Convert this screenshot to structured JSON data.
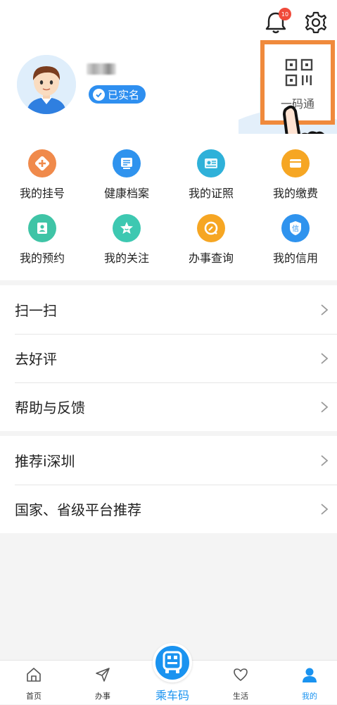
{
  "header": {
    "notification_count": "10",
    "username_masked": "",
    "verified_label": "已实名",
    "qr_label": "一码通"
  },
  "grid": [
    {
      "label": "我的挂号",
      "icon": "plus-icon",
      "color": "#f08a4b"
    },
    {
      "label": "健康档案",
      "icon": "document-icon",
      "color": "#2f93ee"
    },
    {
      "label": "我的证照",
      "icon": "id-card-icon",
      "color": "#2fb1d9"
    },
    {
      "label": "我的缴费",
      "icon": "payment-icon",
      "color": "#f6a623"
    },
    {
      "label": "我的预约",
      "icon": "appointment-icon",
      "color": "#3fc4a6"
    },
    {
      "label": "我的关注",
      "icon": "star-icon",
      "color": "#3dc8b1"
    },
    {
      "label": "办事查询",
      "icon": "search-icon",
      "color": "#f6a623"
    },
    {
      "label": "我的信用",
      "icon": "credit-icon",
      "color": "#2f93ee"
    }
  ],
  "menu1": [
    "扫一扫",
    "去好评",
    "帮助与反馈"
  ],
  "menu2": [
    "推荐i深圳",
    "国家、省级平台推荐"
  ],
  "tabs": [
    {
      "label": "首页",
      "icon": "home-icon"
    },
    {
      "label": "办事",
      "icon": "send-icon"
    },
    {
      "label": "乘车码",
      "icon": "bus-icon"
    },
    {
      "label": "生活",
      "icon": "heart-icon"
    },
    {
      "label": "我的",
      "icon": "person-icon"
    }
  ],
  "colors": {
    "accent": "#1a93f0",
    "highlight": "#f08a3c"
  }
}
